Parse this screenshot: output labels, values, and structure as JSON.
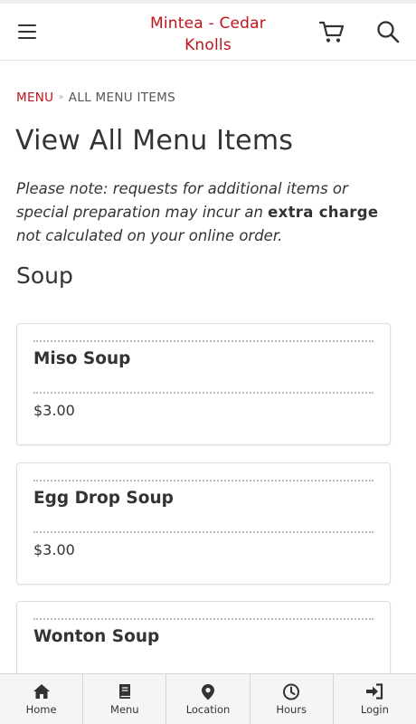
{
  "header": {
    "title": "Mintea - Cedar Knolls"
  },
  "breadcrumb": {
    "link_label": "MENU",
    "separator": "»",
    "current_label": "ALL MENU ITEMS"
  },
  "page": {
    "title": "View All Menu Items",
    "note_before": "Please note: requests for additional items or special preparation may incur an ",
    "note_emphasis": "extra charge",
    "note_after": " not calculated on your online order."
  },
  "section": {
    "title": "Soup",
    "items": [
      {
        "name": "Miso Soup",
        "price": "$3.00"
      },
      {
        "name": "Egg Drop Soup",
        "price": "$3.00"
      },
      {
        "name": "Wonton Soup",
        "price": ""
      }
    ]
  },
  "bottom_nav": [
    {
      "label": "Home",
      "icon": "home-icon"
    },
    {
      "label": "Menu",
      "icon": "book-icon"
    },
    {
      "label": "Location",
      "icon": "map-pin-icon"
    },
    {
      "label": "Hours",
      "icon": "clock-icon"
    },
    {
      "label": "Login",
      "icon": "sign-in-icon"
    }
  ],
  "colors": {
    "brand_red": "#c0141c",
    "text": "#333333",
    "nav_bg": "#f5f5f5"
  }
}
